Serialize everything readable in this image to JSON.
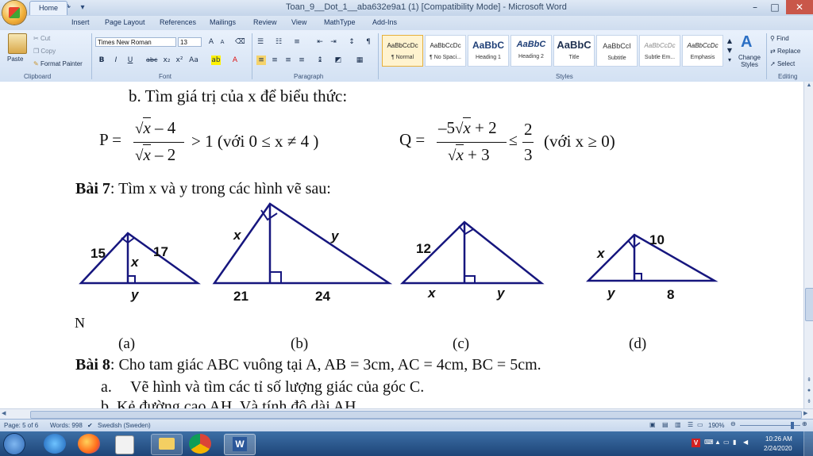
{
  "window": {
    "title": "Toan_9__Dot_1__aba632e9a1 (1) [Compatibility Mode] - Microsoft Word",
    "controls": [
      "–",
      "□",
      "✕"
    ]
  },
  "tabs": [
    "Home",
    "Insert",
    "Page Layout",
    "References",
    "Mailings",
    "Review",
    "View",
    "MathType",
    "Add-Ins"
  ],
  "ribbon": {
    "clipboard": {
      "paste": "Paste",
      "cut": "Cut",
      "copy": "Copy",
      "format_painter": "Format Painter",
      "label": "Clipboard"
    },
    "font": {
      "name": "Times New Roman",
      "size": "13",
      "label": "Font"
    },
    "paragraph": {
      "label": "Paragraph"
    },
    "styles": {
      "label": "Styles",
      "items": [
        {
          "preview": "AaBbCcDc",
          "name": "¶ Normal"
        },
        {
          "preview": "AaBbCcDc",
          "name": "¶ No Spaci..."
        },
        {
          "preview": "AaBbC",
          "name": "Heading 1"
        },
        {
          "preview": "AaBbC",
          "name": "Heading 2"
        },
        {
          "preview": "AaBbC",
          "name": "Title"
        },
        {
          "preview": "AaBbCcI",
          "name": "Subtitle"
        },
        {
          "preview": "AaBbCcDc",
          "name": "Subtle Em..."
        },
        {
          "preview": "AaBbCcDc",
          "name": "Emphasis"
        }
      ],
      "change_styles": "Change Styles"
    },
    "editing": {
      "find": "Find",
      "replace": "Replace",
      "select": "Select",
      "label": "Editing"
    }
  },
  "document": {
    "line_b": "b. Tìm giá trị của x để biểu thức:",
    "formula_p": {
      "lhs": "P =",
      "num_rad": "x",
      "num_rest": " – 4",
      "den_rad": "x",
      "den_rest": " – 2",
      "cond": "> 1 (với 0 ≤ x ≠ 4 )"
    },
    "formula_q": {
      "lhs": "Q =",
      "num_pre": "–5",
      "num_rad": "x",
      "num_rest": " + 2",
      "den_rad": "x",
      "den_rest": " + 3",
      "op": "≤",
      "frac_num": "2",
      "frac_den": "3",
      "cond": "(với x ≥ 0)"
    },
    "bai7_label": "Bài 7",
    "bai7_text": ": Tìm x và y trong các hình vẽ sau:",
    "figures": [
      {
        "caption": "(a)",
        "labels": [
          "15",
          "17",
          "x",
          "y"
        ]
      },
      {
        "caption": "(b)",
        "labels": [
          "x",
          "y",
          "21",
          "24"
        ]
      },
      {
        "caption": "(c)",
        "labels": [
          "12",
          "x",
          "y"
        ]
      },
      {
        "caption": "(d)",
        "labels": [
          "x",
          "10",
          "y",
          "8"
        ]
      }
    ],
    "stray_char": "N",
    "bai8_label": "Bài 8",
    "bai8_text": ":  Cho tam giác ABC vuông tại A, AB = 3cm, AC = 4cm, BC = 5cm.",
    "item_a_marker": "a.",
    "item_a_text": "Vẽ hình và tìm các tỉ số lượng giác của góc C.",
    "item_b_partial": "b.   Kẻ đường cao AH. Và tính độ dài AH."
  },
  "status": {
    "page": "Page: 5 of 6",
    "words": "Words: 998",
    "language": "Swedish (Sweden)",
    "zoom": "190%"
  },
  "tray": {
    "time": "10:26 AM",
    "date": "2/24/2020"
  }
}
